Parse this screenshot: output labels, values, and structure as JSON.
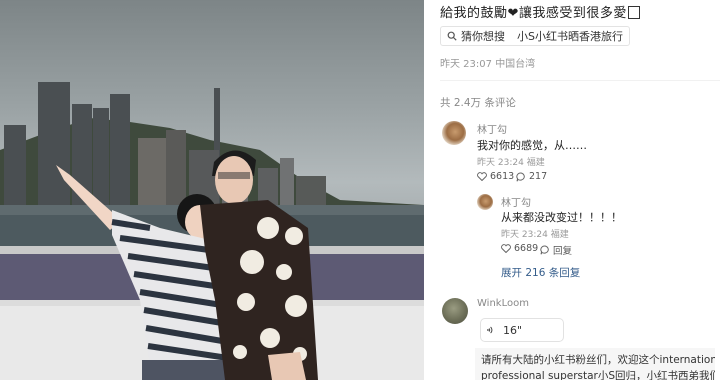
{
  "post": {
    "caption": "給我的鼓勵",
    "caption_suffix": "讓我感受到很多愛",
    "heart_glyph": "❤",
    "search_chip": {
      "label": "猜你想搜",
      "query": "小S小红书晒香港旅行"
    },
    "time": "昨天 23:07",
    "location": "中国台湾"
  },
  "comments": {
    "total_label": "共 2.4万 条评论",
    "items": [
      {
        "author": "林丁勾",
        "text": "我对你的感觉，从……",
        "time": "昨天 23:24",
        "location": "福建",
        "likes": "6613",
        "replies": "217"
      }
    ],
    "reply": {
      "author": "林丁勾",
      "text": "从来都没改变过！！！！",
      "time": "昨天 23:24",
      "location": "福建",
      "likes": "6689",
      "reply_label": "回复"
    },
    "expand_label": "展开 216 条回复",
    "second": {
      "author": "WinkLoom",
      "voice_duration": "16\"",
      "translation_line1": "请所有大陆的小红书粉丝们，欢迎这个international",
      "translation_line2": "professional superstar小S回归，小红书西弟我们爱"
    }
  },
  "colors": {
    "link": "#355d8b",
    "meta": "#999999",
    "text": "#222222"
  }
}
